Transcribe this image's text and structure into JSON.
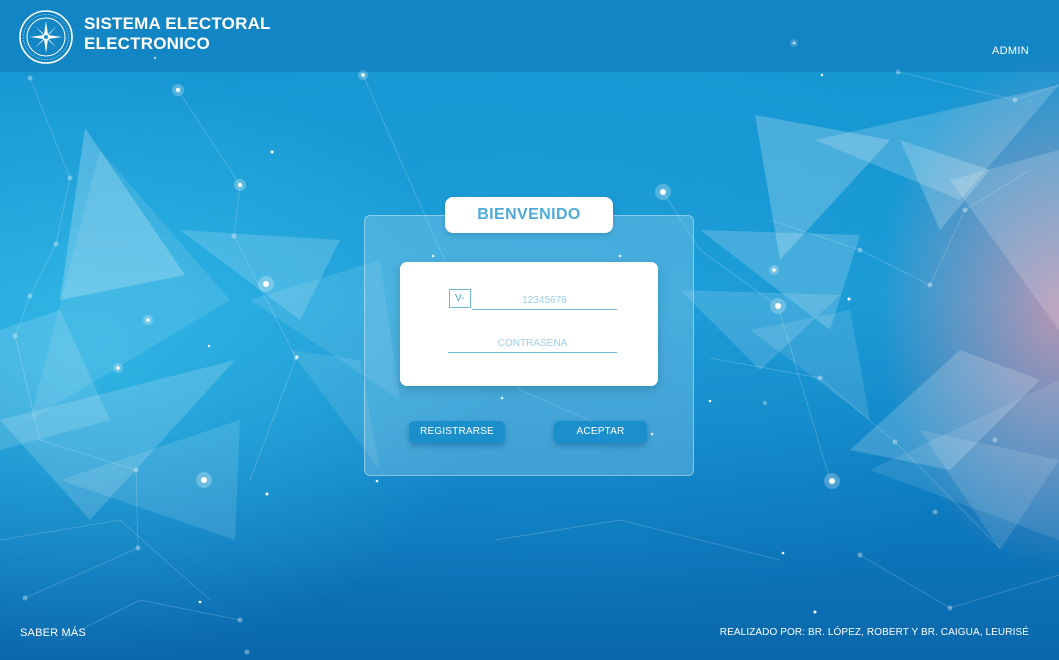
{
  "header": {
    "title_line1": "SISTEMA ELECTORAL",
    "title_line2": "ELECTRONICO",
    "admin_label": "ADMIN",
    "logo_icon": "university-seal-icon"
  },
  "login": {
    "heading": "BIENVENIDO",
    "id_prefix": "V-",
    "id_placeholder": "12345678",
    "password_placeholder": "CONTRASEÑA",
    "register_label": "REGISTRARSE",
    "accept_label": "ACEPTAR"
  },
  "footer": {
    "more_label": "SABER MÁS",
    "credits": "REALIZADO POR: BR. LÓPEZ, ROBERT Y BR. CAIGUA, LEURISÉ"
  },
  "colors": {
    "accent": "#4eaad8",
    "button": "#1b8fcb",
    "background_top": "#1596d2",
    "background_bottom": "#0a67ab",
    "glow_right": "#e896aa"
  }
}
